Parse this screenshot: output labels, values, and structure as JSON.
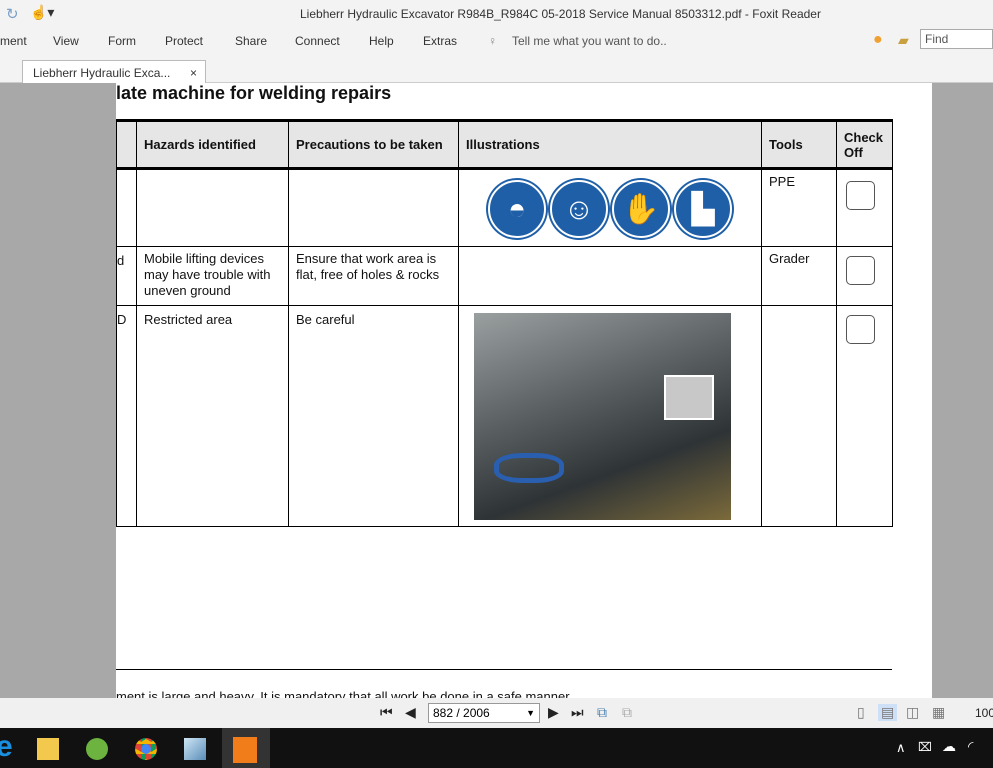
{
  "window": {
    "title": "Liebherr Hydraulic Excavator R984B_R984C 05-2018 Service Manual 8503312.pdf - Foxit Reader"
  },
  "menu": [
    "ment",
    "View",
    "Form",
    "Protect",
    "Share",
    "Connect",
    "Help",
    "Extras"
  ],
  "tell_me": "Tell me what you want to do..",
  "find_placeholder": "Find",
  "tab": {
    "label": "Liebherr Hydraulic Exca...",
    "close": "×"
  },
  "doc": {
    "heading": "late machine for welding repairs",
    "headers": [
      "",
      "Hazards identified",
      "Precautions to be taken",
      "Illustrations",
      "Tools",
      "Check Off"
    ],
    "rows": [
      {
        "c0": "",
        "hazard": "",
        "precaution": "",
        "tools": "PPE"
      },
      {
        "c0": "d",
        "hazard": "Mobile lifting devices may have trouble with uneven ground",
        "precaution": "Ensure that work area is flat, free of holes & rocks",
        "tools": "Grader"
      },
      {
        "c0": "D",
        "hazard": "Restricted area",
        "precaution": "Be careful",
        "tools": ""
      }
    ],
    "ppe_icons": [
      "hard-hat-icon",
      "goggles-icon",
      "gloves-icon",
      "boots-icon"
    ],
    "footer_cut": "ment is large and heavy. It is mandatory that all work be done in a safe manner."
  },
  "status": {
    "page": "882 / 2006",
    "zoom": "100"
  },
  "colors": {
    "ppe_blue": "#1e5fa8"
  }
}
